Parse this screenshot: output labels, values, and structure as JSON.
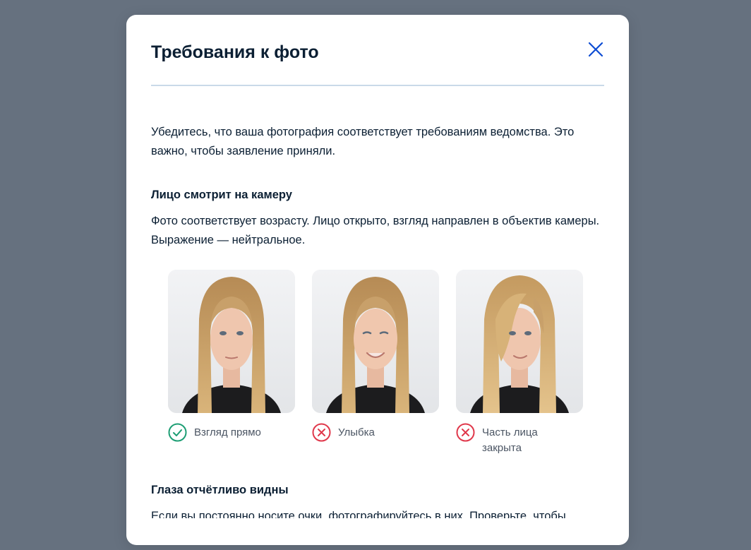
{
  "modal": {
    "title": "Требования к фото",
    "close_icon": "close-icon",
    "intro": "Убедитесь, что ваша фотография соответствует требованиям ведомства. Это важно, чтобы заявление приняли."
  },
  "sections": [
    {
      "heading": "Лицо смотрит на камеру",
      "text": "Фото соответствует возрасту. Лицо открыто, взгляд направлен в объектив камеры. Выражение — нейтральное."
    },
    {
      "heading": "Глаза отчётливо видны",
      "text": "Если вы постоянно носите очки, фотографируйтесь в них. Проверьте, чтобы"
    }
  ],
  "examples": [
    {
      "label": "Взгляд прямо",
      "status": "ok",
      "icon": "check-circle-icon"
    },
    {
      "label": "Улыбка",
      "status": "bad",
      "icon": "cross-circle-icon"
    },
    {
      "label": "Часть лица закрыта",
      "status": "bad",
      "icon": "cross-circle-icon"
    }
  ],
  "colors": {
    "title": "#0b1f33",
    "accent": "#0d4cd3",
    "ok": "#1d9e74",
    "bad": "#e0384b",
    "divider": "#c9d9e8",
    "backdrop": "#66717f"
  }
}
